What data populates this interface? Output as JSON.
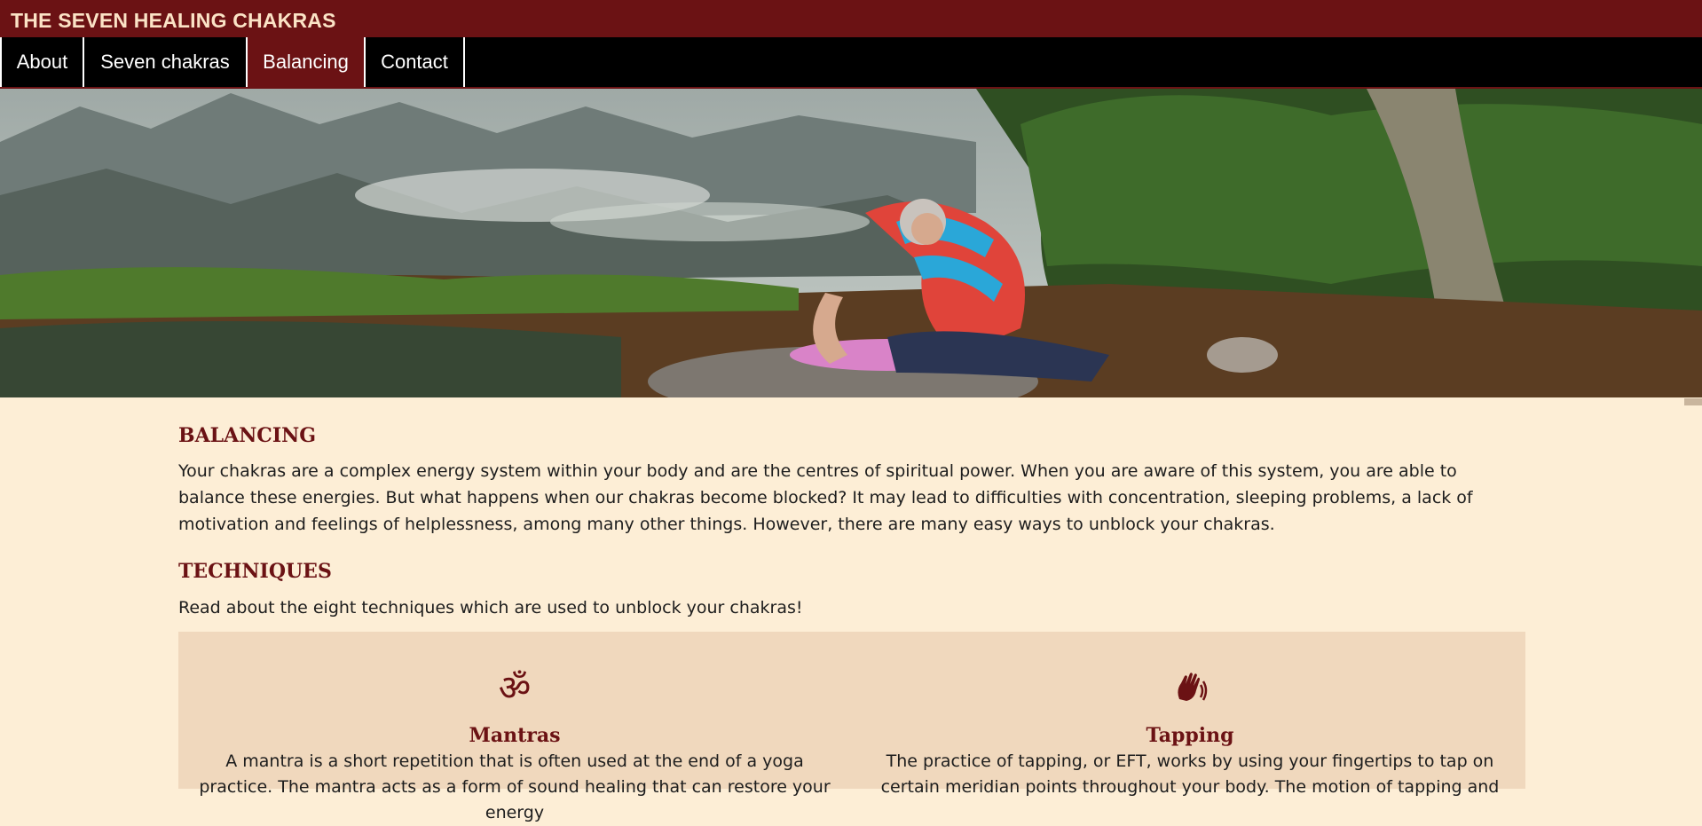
{
  "header": {
    "title": "THE SEVEN HEALING CHAKRAS"
  },
  "nav": {
    "items": [
      {
        "label": "About",
        "active": false
      },
      {
        "label": "Seven chakras",
        "active": false
      },
      {
        "label": "Balancing",
        "active": true
      },
      {
        "label": "Contact",
        "active": false
      }
    ]
  },
  "colors": {
    "brand": "#6b1214",
    "page_background": "#fdeed6",
    "panel_background": "#f0d8bd",
    "nav_background": "#000000"
  },
  "balancing": {
    "heading": "BALANCING",
    "text": "Your chakras are a complex energy system within your body and are the centres of spiritual power. When you are aware of this system, you are able to balance these energies. But what happens when our chakras become blocked? It may lead to difficulties with concentration, sleeping problems, a lack of motivation and feelings of helplessness, among many other things. However, there are many easy ways to unblock your chakras."
  },
  "techniques": {
    "heading": "TECHNIQUES",
    "intro": "Read about the eight techniques which are used to unblock your chakras!",
    "cards": [
      {
        "icon": "om-icon",
        "title": "Mantras",
        "text": "A mantra is a short repetition that is often used at the end of a yoga practice. The mantra acts as a form of sound healing that can restore your energy"
      },
      {
        "icon": "tapping-hand-icon",
        "title": "Tapping",
        "text": "The practice of tapping, or EFT, works by using your fingertips to tap on certain meridian points throughout your body. The motion of tapping and"
      }
    ]
  }
}
